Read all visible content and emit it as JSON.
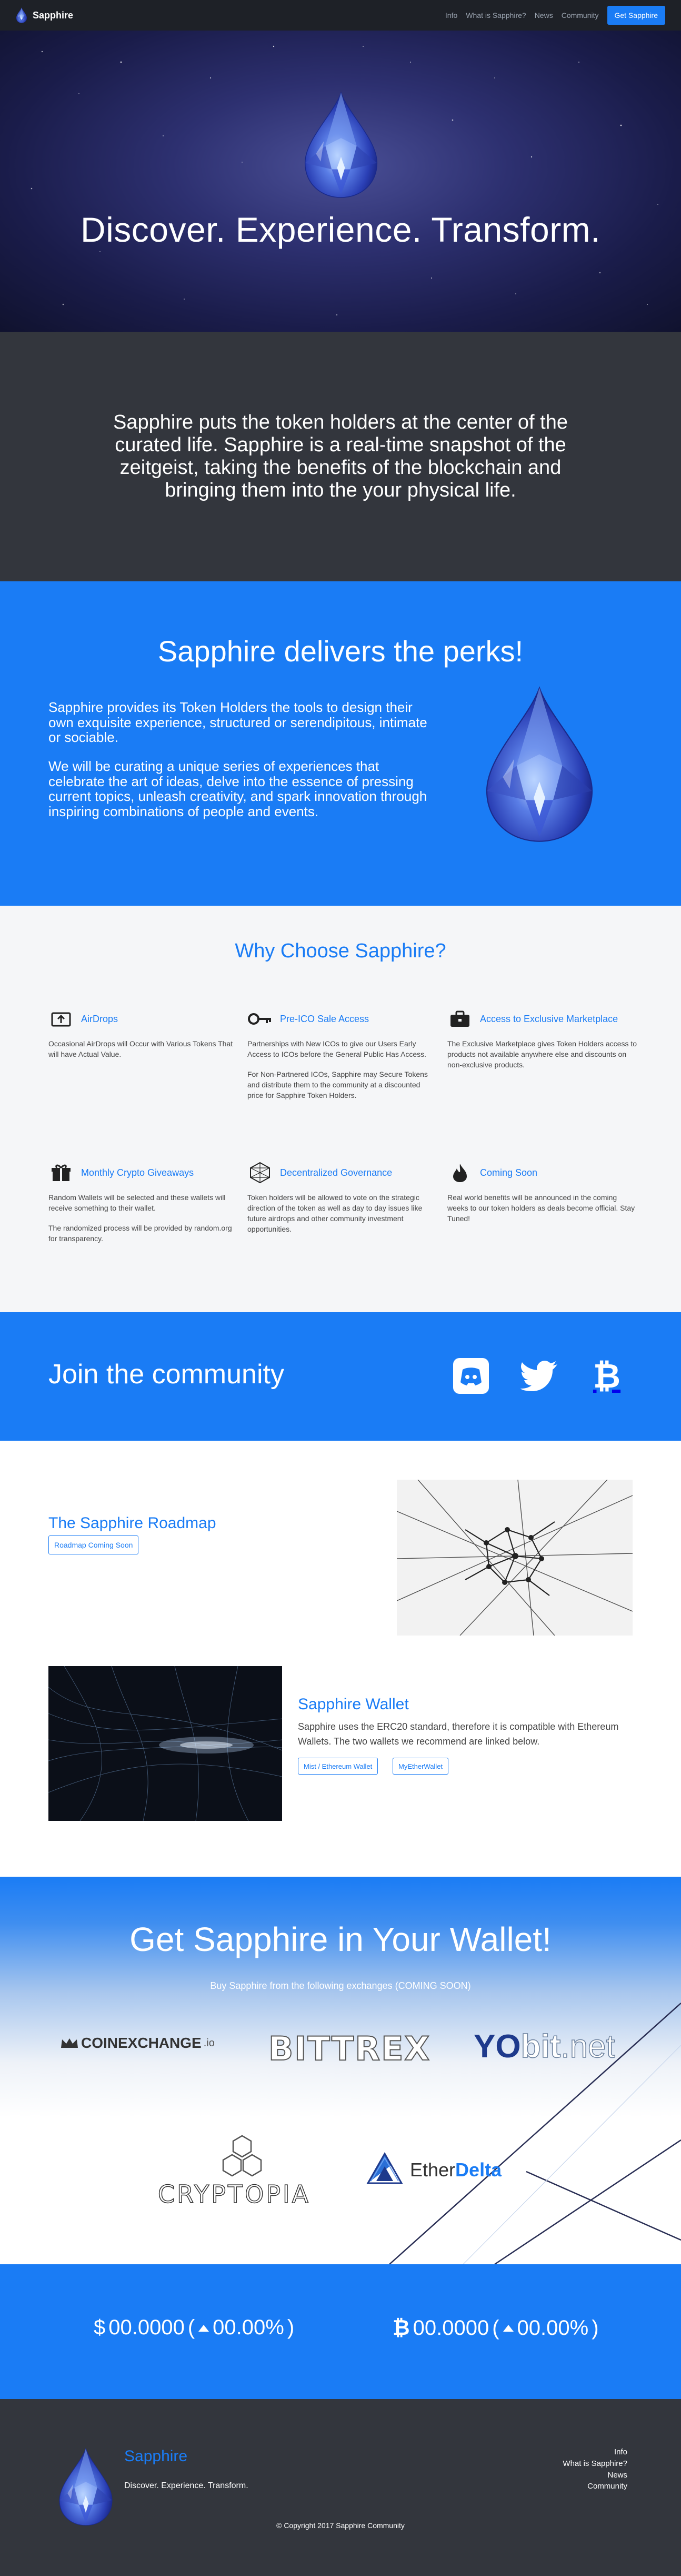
{
  "nav": {
    "brand": "Sapphire",
    "links": [
      "Info",
      "What is Sapphire?",
      "News",
      "Community"
    ],
    "cta": "Get Sapphire"
  },
  "hero": {
    "title": "Discover. Experience. Transform."
  },
  "intro": {
    "text": "Sapphire puts the token holders at the center of the curated life.  Sapphire is a real-time snapshot of the zeitgeist, taking the benefits of the blockchain and bringing them into the your physical life."
  },
  "perks": {
    "title": "Sapphire delivers the perks!",
    "p1": "Sapphire provides its Token Holders the tools to design their own exquisite experience, structured or serendipitous, intimate or sociable.",
    "p2": "We will be curating a unique series of experiences that celebrate the art of ideas, delve into the essence of pressing current topics, unleash creativity, and spark innovation through inspiring combinations of people and events."
  },
  "why": {
    "title": "Why Choose Sapphire?",
    "features": [
      {
        "title": "AirDrops",
        "icon": "airdrop-icon",
        "desc": [
          "Occasional AirDrops will Occur with Various Tokens That will have Actual Value."
        ]
      },
      {
        "title": "Pre-ICO Sale Access",
        "icon": "key-icon",
        "desc": [
          "Partnerships with New ICOs to give our Users Early Access to ICOs before the General Public Has Access.",
          "For Non-Partnered ICOs, Sapphire may Secure Tokens and distribute them to the community at a discounted price for Sapphire Token Holders."
        ]
      },
      {
        "title": "Access to Exclusive Marketplace",
        "icon": "briefcase-icon",
        "desc": [
          "The Exclusive Marketplace gives Token Holders access to products not available anywhere else and discounts on non-exclusive products."
        ]
      },
      {
        "title": "Monthly Crypto Giveaways",
        "icon": "gift-icon",
        "desc": [
          "Random Wallets will be selected and these wallets will receive something to their wallet.",
          "The randomized process will be provided by random.org for transparency."
        ]
      },
      {
        "title": "Decentralized Governance",
        "icon": "network-icon",
        "desc": [
          "Token holders will be allowed to vote on the strategic direction of the token as well as day to day issues like future airdrops and other community investment opportunities."
        ]
      },
      {
        "title": "Coming Soon",
        "icon": "flame-icon",
        "desc": [
          "Real world benefits will be announced in the coming weeks to our token holders as deals become official. Stay Tuned!"
        ]
      }
    ]
  },
  "community": {
    "title": "Join the community",
    "icons": [
      "discord-icon",
      "twitter-icon",
      "bitcoin-icon"
    ]
  },
  "roadmap": {
    "title": "The Sapphire Roadmap",
    "button": "Roadmap Coming Soon"
  },
  "wallet": {
    "title": "Sapphire Wallet",
    "desc": "Sapphire uses the ERC20 standard, therefore it is compatible with Ethereum Wallets. The two wallets we recommend are linked below.",
    "buttons": [
      "Mist / Ethereum Wallet",
      "MyEtherWallet"
    ]
  },
  "exchanges": {
    "title": "Get Sapphire in Your Wallet!",
    "subtitle": "Buy Sapphire from the following exchanges (COMING SOON)",
    "logos": {
      "coinexchange": "COINEXCHANGE",
      "coinexchange_suffix": ".io",
      "bittrex": "BITTREX",
      "yobit_a": "YO",
      "yobit_b": "bit",
      "yobit_c": ".net",
      "cryptopia": "CRYPTOPIA",
      "etherdelta_a": "Ether",
      "etherdelta_b": "Delta"
    }
  },
  "prices": {
    "usd": {
      "symbol": "$",
      "value": "00.0000",
      "change": "00.00%"
    },
    "btc": {
      "symbol": "₿",
      "value": "00.0000",
      "change": "00.00%"
    }
  },
  "footer": {
    "brand": "Sapphire",
    "tagline": "Discover. Experience. Transform.",
    "links": [
      "Info",
      "What is Sapphire?",
      "News",
      "Community"
    ],
    "copyright": "© Copyright 2017 Sapphire Community"
  },
  "colors": {
    "accent": "#1a7cf5",
    "dark": "#33363d",
    "navbar": "#1e2127"
  }
}
